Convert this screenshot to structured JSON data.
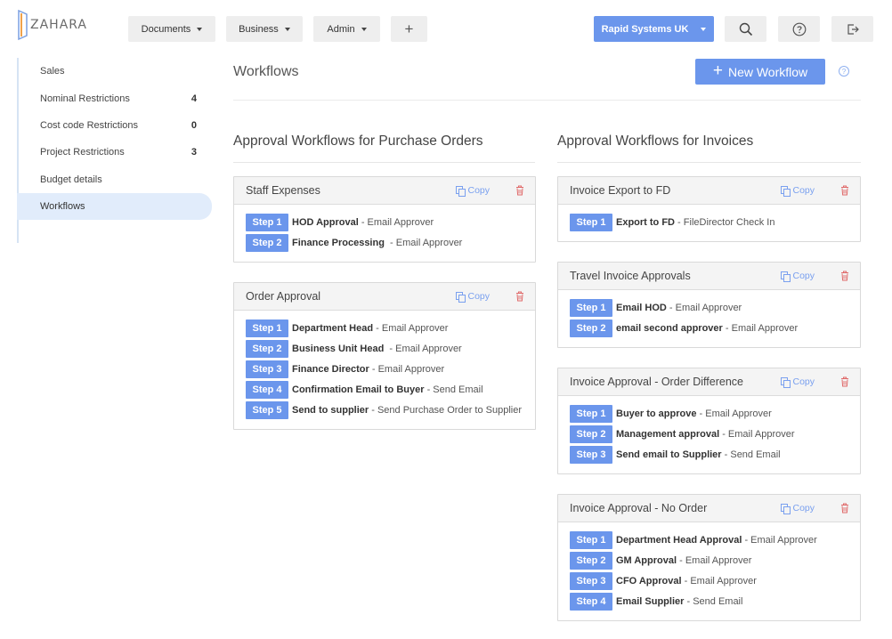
{
  "app": {
    "logo_text": "ZAHARA"
  },
  "nav": {
    "items": [
      {
        "label": "Documents"
      },
      {
        "label": "Business"
      },
      {
        "label": "Admin"
      }
    ],
    "add_label": "+",
    "company": "Rapid Systems UK"
  },
  "sidebar": {
    "items": [
      {
        "label": "Sales",
        "count": ""
      },
      {
        "label": "Nominal Restrictions",
        "count": "4"
      },
      {
        "label": "Cost code Restrictions",
        "count": "0"
      },
      {
        "label": "Project Restrictions",
        "count": "3"
      },
      {
        "label": "Budget details",
        "count": ""
      },
      {
        "label": "Workflows",
        "count": "",
        "active": true
      }
    ]
  },
  "main": {
    "title": "Workflows",
    "new_button": "New Workflow",
    "help": "?",
    "copy_label": "Copy",
    "step_prefix": "Step",
    "columns": [
      {
        "title": "Approval Workflows for Purchase Orders",
        "workflows": [
          {
            "name": "Staff Expenses",
            "steps": [
              {
                "name": "HOD Approval",
                "action": " - Email Approver"
              },
              {
                "name": "Finance Processing ",
                "action": " - Email Approver"
              }
            ]
          },
          {
            "name": "Order Approval",
            "steps": [
              {
                "name": "Department Head",
                "action": " - Email Approver"
              },
              {
                "name": "Business Unit Head ",
                "action": " - Email Approver"
              },
              {
                "name": "Finance Director",
                "action": " - Email Approver"
              },
              {
                "name": "Confirmation Email to Buyer",
                "action": " - Send Email"
              },
              {
                "name": "Send to supplier",
                "action": " - Send Purchase Order to Supplier"
              }
            ]
          }
        ]
      },
      {
        "title": "Approval Workflows for Invoices",
        "workflows": [
          {
            "name": "Invoice Export to FD",
            "steps": [
              {
                "name": "Export to FD",
                "action": " - FileDirector Check In"
              }
            ]
          },
          {
            "name": "Travel Invoice Approvals",
            "steps": [
              {
                "name": "Email HOD",
                "action": " - Email Approver"
              },
              {
                "name": "email second approver",
                "action": " - Email Approver"
              }
            ]
          },
          {
            "name": "Invoice Approval - Order Difference",
            "steps": [
              {
                "name": "Buyer to approve",
                "action": " - Email Approver"
              },
              {
                "name": "Management approval",
                "action": " - Email Approver"
              },
              {
                "name": "Send email to Supplier",
                "action": " - Send Email"
              }
            ]
          },
          {
            "name": "Invoice Approval - No Order",
            "steps": [
              {
                "name": "Department Head Approval",
                "action": " - Email Approver"
              },
              {
                "name": "GM Approval",
                "action": " - Email Approver"
              },
              {
                "name": "CFO Approval",
                "action": " - Email Approver"
              },
              {
                "name": "Email Supplier",
                "action": " - Send Email"
              }
            ]
          }
        ]
      }
    ]
  },
  "colors": {
    "accent": "#6b96ec",
    "link": "#7aa0ef",
    "delete": "#e06a6a"
  },
  "icons": [
    "logo-mark",
    "caret-down-icon",
    "plus-icon",
    "search-icon",
    "help-icon",
    "logout-icon",
    "copy-icon",
    "trash-icon"
  ]
}
